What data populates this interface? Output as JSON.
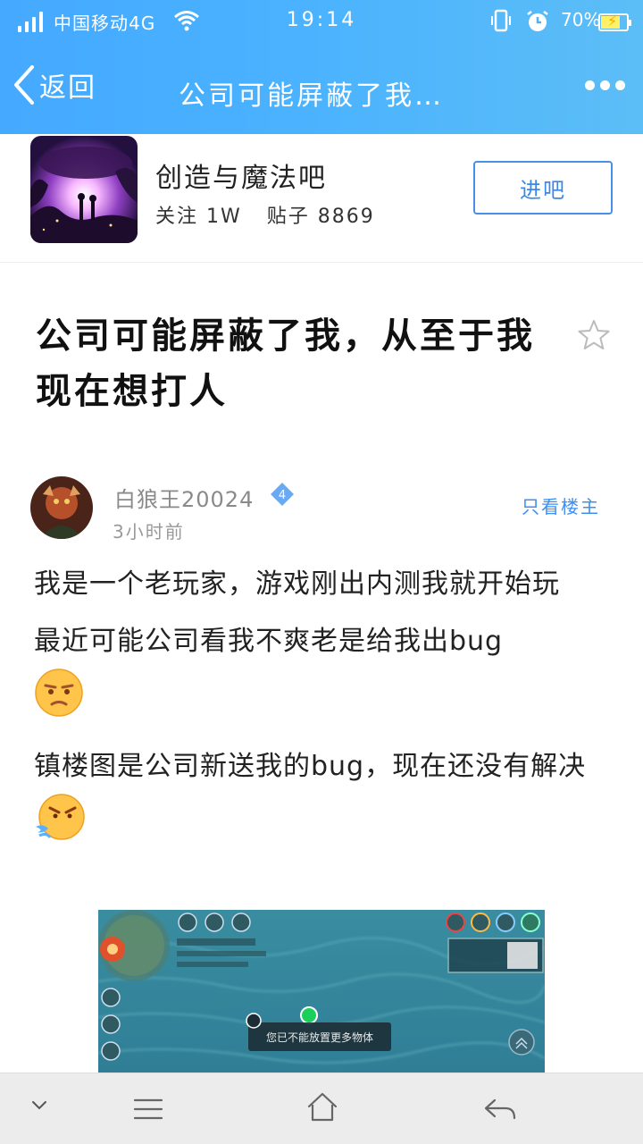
{
  "status_bar": {
    "carrier": "中国移动4G",
    "time": "19:14",
    "battery": "70%"
  },
  "nav": {
    "back_label": "返回",
    "title": "公司可能屏蔽了我…"
  },
  "forum": {
    "name": "创造与魔法吧",
    "followers": "关注 1W",
    "posts": "贴子 8869",
    "enter_label": "进吧"
  },
  "post": {
    "title": "公司可能屏蔽了我，从至于我现在想打人",
    "author": "白狼王20024",
    "level": "4",
    "time": "3小时前",
    "only_owner_label": "只看楼主",
    "paragraphs": [
      "我是一个老玩家，游戏刚出内测我就开始玩",
      "最近可能公司看我不爽老是给我出bug",
      "镇楼图是公司新送我的bug，现在还没有解决"
    ],
    "screenshot_hint": "您已不能放置更多物体"
  },
  "colors": {
    "accent": "#4ab2ff",
    "link": "#3d8ff2"
  }
}
